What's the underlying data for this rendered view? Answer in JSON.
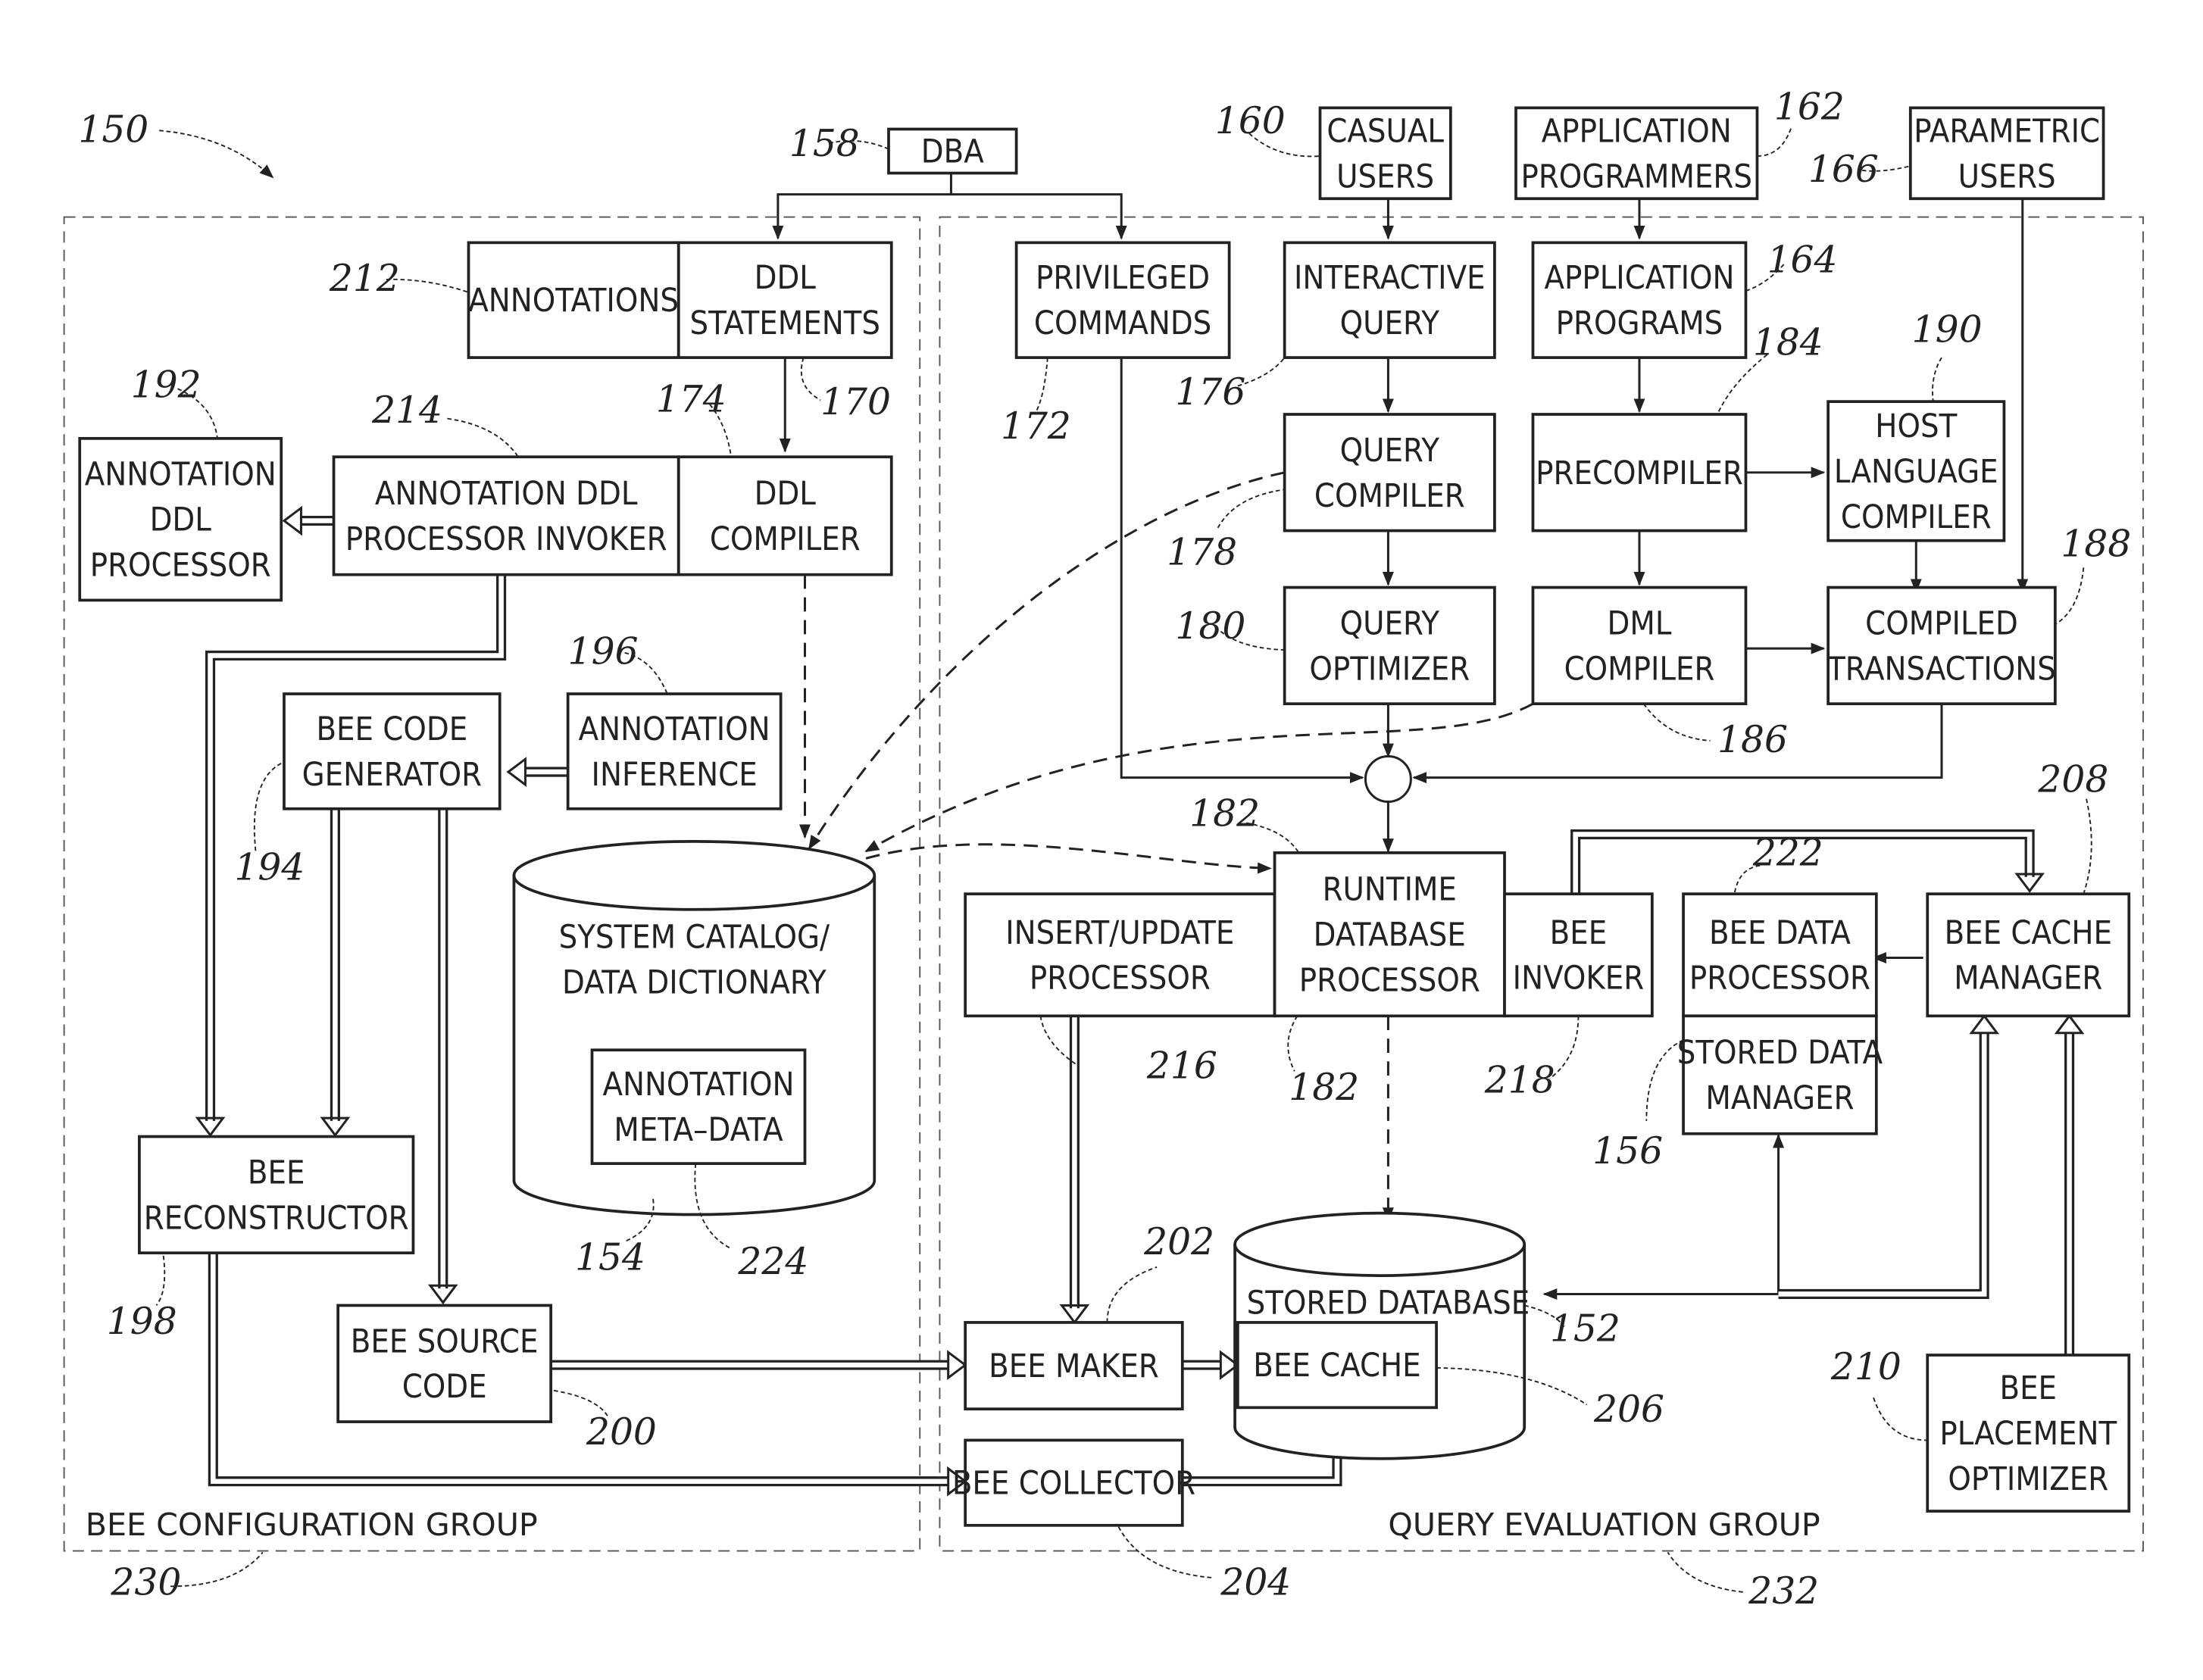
{
  "figure": {
    "ref": "150",
    "groups": {
      "config": {
        "label": "BEE CONFIGURATION GROUP",
        "ref": "230"
      },
      "query": {
        "label": "QUERY EVALUATION GROUP",
        "ref": "232"
      }
    },
    "boxes": {
      "dba": {
        "lines": [
          "DBA"
        ],
        "ref": "158"
      },
      "casual": {
        "lines": [
          "CASUAL",
          "USERS"
        ],
        "ref": "160"
      },
      "appprog": {
        "lines": [
          "APPLICATION",
          "PROGRAMMERS"
        ],
        "ref": "162"
      },
      "param": {
        "lines": [
          "PARAMETRIC",
          "USERS"
        ],
        "ref": "166"
      },
      "annotations": {
        "lines": [
          "ANNOTATIONS"
        ],
        "ref": "212"
      },
      "ddlstmt": {
        "lines": [
          "DDL",
          "STATEMENTS"
        ],
        "ref": "170"
      },
      "privcmd": {
        "lines": [
          "PRIVILEGED",
          "COMMANDS"
        ],
        "ref": "172"
      },
      "interq": {
        "lines": [
          "INTERACTIVE",
          "QUERY"
        ],
        "ref": "176"
      },
      "appprograms": {
        "lines": [
          "APPLICATION",
          "PROGRAMS"
        ],
        "ref": "164"
      },
      "addlproc": {
        "lines": [
          "ANNOTATION",
          "DDL",
          "PROCESSOR"
        ],
        "ref": "192"
      },
      "addlinv": {
        "lines": [
          "ANNOTATION DDL",
          "PROCESSOR INVOKER"
        ],
        "ref": "214"
      },
      "ddlcomp": {
        "lines": [
          "DDL",
          "COMPILER"
        ],
        "ref": "174"
      },
      "qcomp": {
        "lines": [
          "QUERY",
          "COMPILER"
        ],
        "ref": "178"
      },
      "precomp": {
        "lines": [
          "PRECOMPILER"
        ],
        "ref": "184"
      },
      "hostlang": {
        "lines": [
          "HOST",
          "LANGUAGE",
          "COMPILER"
        ],
        "ref": "190"
      },
      "qopt": {
        "lines": [
          "QUERY",
          "OPTIMIZER"
        ],
        "ref": "180"
      },
      "dmlcomp": {
        "lines": [
          "DML",
          "COMPILER"
        ],
        "ref": "186"
      },
      "comptx": {
        "lines": [
          "COMPILED",
          "TRANSACTIONS"
        ],
        "ref": "188"
      },
      "beecodegen": {
        "lines": [
          "BEE CODE",
          "GENERATOR"
        ],
        "ref": "194"
      },
      "anninf": {
        "lines": [
          "ANNOTATION",
          "INFERENCE"
        ],
        "ref": "196"
      },
      "syscat": {
        "lines": [
          "SYSTEM CATALOG/",
          "DATA DICTIONARY"
        ],
        "ref": "154"
      },
      "annmeta": {
        "lines": [
          "ANNOTATION",
          "META–DATA"
        ],
        "ref": "224"
      },
      "insupd": {
        "lines": [
          "INSERT/UPDATE",
          "PROCESSOR"
        ],
        "ref": "216"
      },
      "runtime": {
        "lines": [
          "RUNTIME",
          "DATABASE",
          "PROCESSOR"
        ],
        "ref": "182"
      },
      "beeinv": {
        "lines": [
          "BEE",
          "INVOKER"
        ],
        "ref": "218"
      },
      "beedata": {
        "lines": [
          "BEE DATA",
          "PROCESSOR"
        ],
        "ref": "222"
      },
      "storedmgr": {
        "lines": [
          "STORED DATA",
          "MANAGER"
        ],
        "ref": "156"
      },
      "beecachemgr": {
        "lines": [
          "BEE CACHE",
          "MANAGER"
        ],
        "ref": "208"
      },
      "beerecon": {
        "lines": [
          "BEE",
          "RECONSTRUCTOR"
        ],
        "ref": "198"
      },
      "beesrc": {
        "lines": [
          "BEE SOURCE",
          "CODE"
        ],
        "ref": "200"
      },
      "beemaker": {
        "lines": [
          "BEE MAKER"
        ],
        "ref": "202"
      },
      "storeddb": {
        "lines": [
          "STORED DATABASE"
        ],
        "ref": "152"
      },
      "beecache": {
        "lines": [
          "BEE CACHE"
        ],
        "ref": "206"
      },
      "beecoll": {
        "lines": [
          "BEE COLLECTOR"
        ],
        "ref": "204"
      },
      "beeplace": {
        "lines": [
          "BEE",
          "PLACEMENT",
          "OPTIMIZER"
        ],
        "ref": "210"
      }
    },
    "extra_refs": {
      "runtime_top": "182"
    }
  }
}
